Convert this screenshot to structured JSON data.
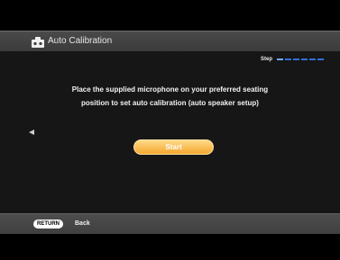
{
  "header": {
    "title": "Auto Calibration",
    "icon": "speaker-setup-icon"
  },
  "progress": {
    "label": "Step",
    "total_steps": 6,
    "current_step": 1
  },
  "main": {
    "instruction_lines": [
      "Place the supplied microphone on your preferred seating",
      "position to set auto calibration (auto speaker setup)"
    ],
    "start_label": "Start"
  },
  "footer": {
    "return_key_label": "RETURN",
    "back_label": "Back"
  },
  "colors": {
    "accent": "#f4a72d",
    "step_indicator": "#2f6fd6",
    "bar": "#4a4a4a",
    "panel": "#161616"
  }
}
